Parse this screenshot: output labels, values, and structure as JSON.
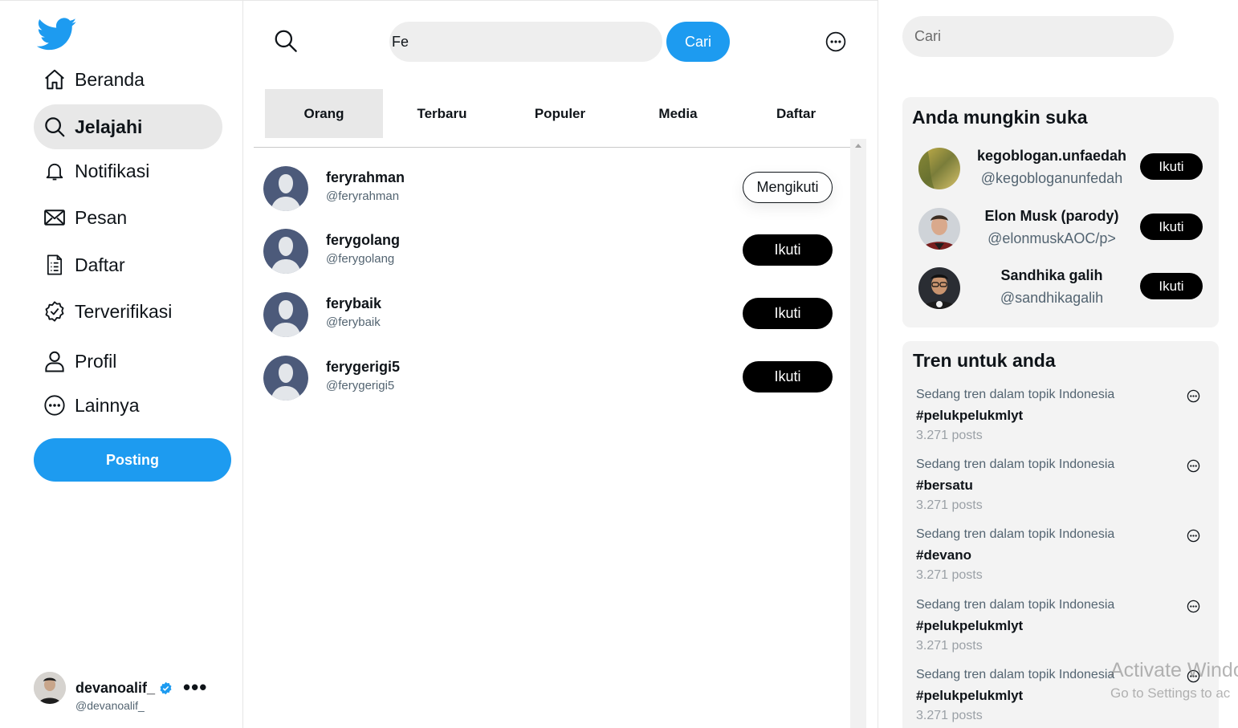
{
  "sidebar": {
    "logo": "twitter-bird-icon",
    "items": [
      {
        "label": "Beranda",
        "icon": "home-icon"
      },
      {
        "label": "Jelajahi",
        "icon": "search-icon"
      },
      {
        "label": "Notifikasi",
        "icon": "bell-icon"
      },
      {
        "label": "Pesan",
        "icon": "mail-icon"
      },
      {
        "label": "Daftar",
        "icon": "list-icon"
      },
      {
        "label": "Terverifikasi",
        "icon": "verified-badge-icon"
      },
      {
        "label": "Profil",
        "icon": "person-icon"
      },
      {
        "label": "Lainnya",
        "icon": "more-circle-icon"
      }
    ],
    "post_label": "Posting",
    "account": {
      "name": "devanoalif_",
      "handle": "@devanoalif_"
    }
  },
  "search": {
    "value": "Fe",
    "button_label": "Cari"
  },
  "tabs": [
    {
      "label": "Orang"
    },
    {
      "label": "Terbaru"
    },
    {
      "label": "Populer"
    },
    {
      "label": "Media"
    },
    {
      "label": "Daftar"
    }
  ],
  "results": [
    {
      "name": "feryrahman",
      "handle": "@feryrahman",
      "action": "Mengikuti"
    },
    {
      "name": "ferygolang",
      "handle": "@ferygolang",
      "action": "Ikuti"
    },
    {
      "name": "ferybaik",
      "handle": "@ferybaik",
      "action": "Ikuti"
    },
    {
      "name": "ferygerigi5",
      "handle": "@ferygerigi5",
      "action": "Ikuti"
    }
  ],
  "right": {
    "search_placeholder": "Cari",
    "suggest_title": "Anda mungkin suka",
    "suggestions": [
      {
        "name": "kegoblogan.unfaedah",
        "handle": "@kegobloganunfedah",
        "action": "Ikuti"
      },
      {
        "name": "Elon Musk (parody)",
        "handle": "@elonmuskAOC/p>",
        "action": "Ikuti"
      },
      {
        "name": "Sandhika galih",
        "handle": "@sandhikagalih",
        "action": "Ikuti"
      }
    ],
    "trend_title": "Tren untuk anda",
    "trends": [
      {
        "context": "Sedang tren dalam topik Indonesia",
        "tag": "#pelukpelukmlyt",
        "count": "3.271 posts"
      },
      {
        "context": "Sedang tren dalam topik Indonesia",
        "tag": "#bersatu",
        "count": "3.271 posts"
      },
      {
        "context": "Sedang tren dalam topik Indonesia",
        "tag": "#devano",
        "count": "3.271 posts"
      },
      {
        "context": "Sedang tren dalam topik Indonesia",
        "tag": "#pelukpelukmlyt",
        "count": "3.271 posts"
      },
      {
        "context": "Sedang tren dalam topik Indonesia",
        "tag": "#pelukpelukmlyt",
        "count": "3.271 posts"
      }
    ]
  },
  "watermark": {
    "line1": "Activate Windo",
    "line2": "Go to Settings to ac"
  },
  "colors": {
    "accent": "#1d9bf0",
    "follow_button": "#000000",
    "active_tab": "#e8e8e8"
  }
}
